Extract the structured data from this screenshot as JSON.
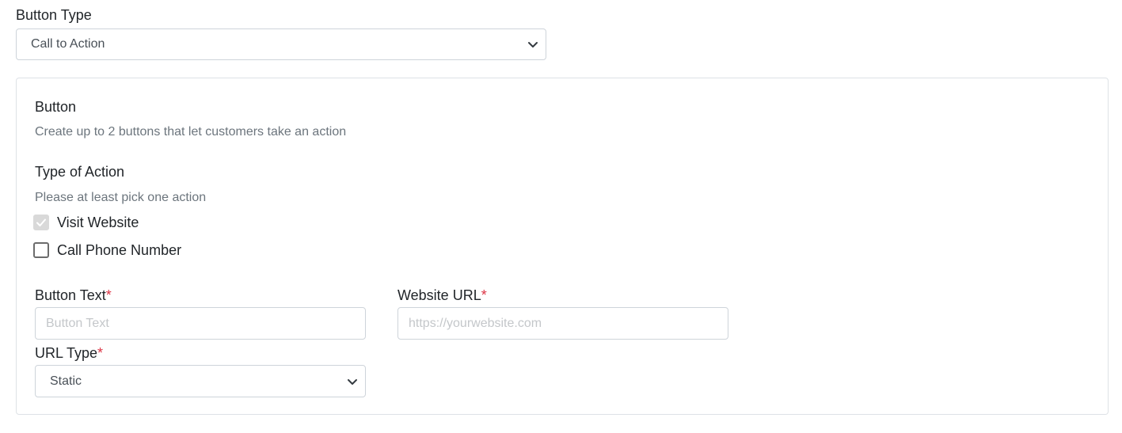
{
  "button_type": {
    "label": "Button Type",
    "selected": "Call to Action"
  },
  "button_card": {
    "title": "Button",
    "description": "Create up to 2 buttons that let customers take an action",
    "type_of_action": {
      "label": "Type of Action",
      "hint": "Please at least pick one action",
      "options": [
        {
          "label": "Visit Website",
          "checked": true,
          "disabled": true
        },
        {
          "label": "Call Phone Number",
          "checked": false,
          "disabled": false
        }
      ]
    },
    "button_text": {
      "label": "Button Text",
      "required_mark": "*",
      "value": "",
      "placeholder": "Button Text"
    },
    "website_url": {
      "label": "Website URL",
      "required_mark": "*",
      "value": "",
      "placeholder": "https://yourwebsite.com"
    },
    "url_type": {
      "label": "URL Type",
      "required_mark": "*",
      "selected": "Static"
    }
  },
  "icons": {
    "dropdown": "chevron-down-icon",
    "check": "check-icon"
  },
  "colors": {
    "required": "#dc3545",
    "border": "#ced4da",
    "muted_text": "#6c757d",
    "disabled_checkbox": "#d9d9d9"
  }
}
